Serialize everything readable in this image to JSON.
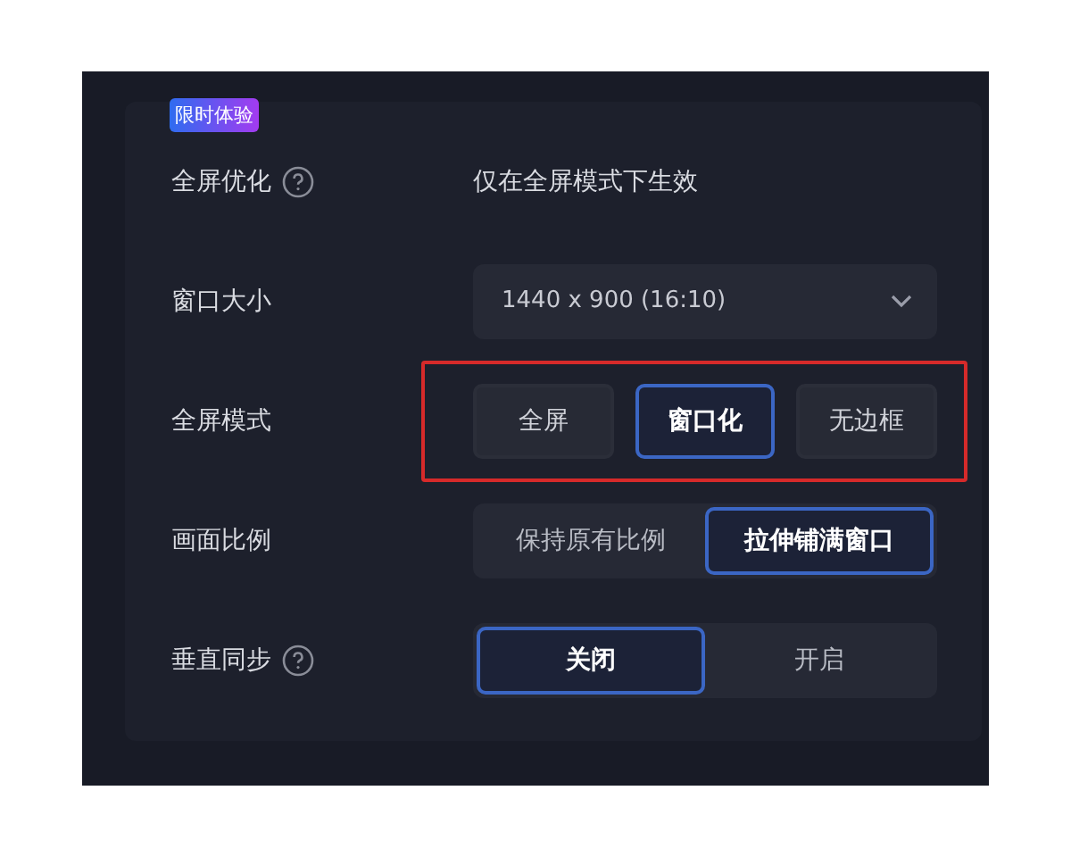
{
  "settings": [
    {
      "kind": "note",
      "label": "全屏优化",
      "help": true,
      "badge": "限时体验",
      "value": "仅在全屏模式下生效"
    },
    {
      "kind": "select",
      "label": "窗口大小",
      "help": false,
      "value": "1440 x 900 (16:10)"
    },
    {
      "kind": "buttons",
      "label": "全屏模式",
      "help": false,
      "highlighted": true,
      "options": [
        {
          "label": "全屏",
          "selected": false
        },
        {
          "label": "窗口化",
          "selected": true
        },
        {
          "label": "无边框",
          "selected": false
        }
      ]
    },
    {
      "kind": "toggle",
      "label": "画面比例",
      "help": false,
      "options": [
        {
          "label": "保持原有比例",
          "selected": false
        },
        {
          "label": "拉伸铺满窗口",
          "selected": true
        }
      ]
    },
    {
      "kind": "toggle",
      "label": "垂直同步",
      "help": true,
      "options": [
        {
          "label": "关闭",
          "selected": true
        },
        {
          "label": "开启",
          "selected": false
        }
      ]
    }
  ]
}
